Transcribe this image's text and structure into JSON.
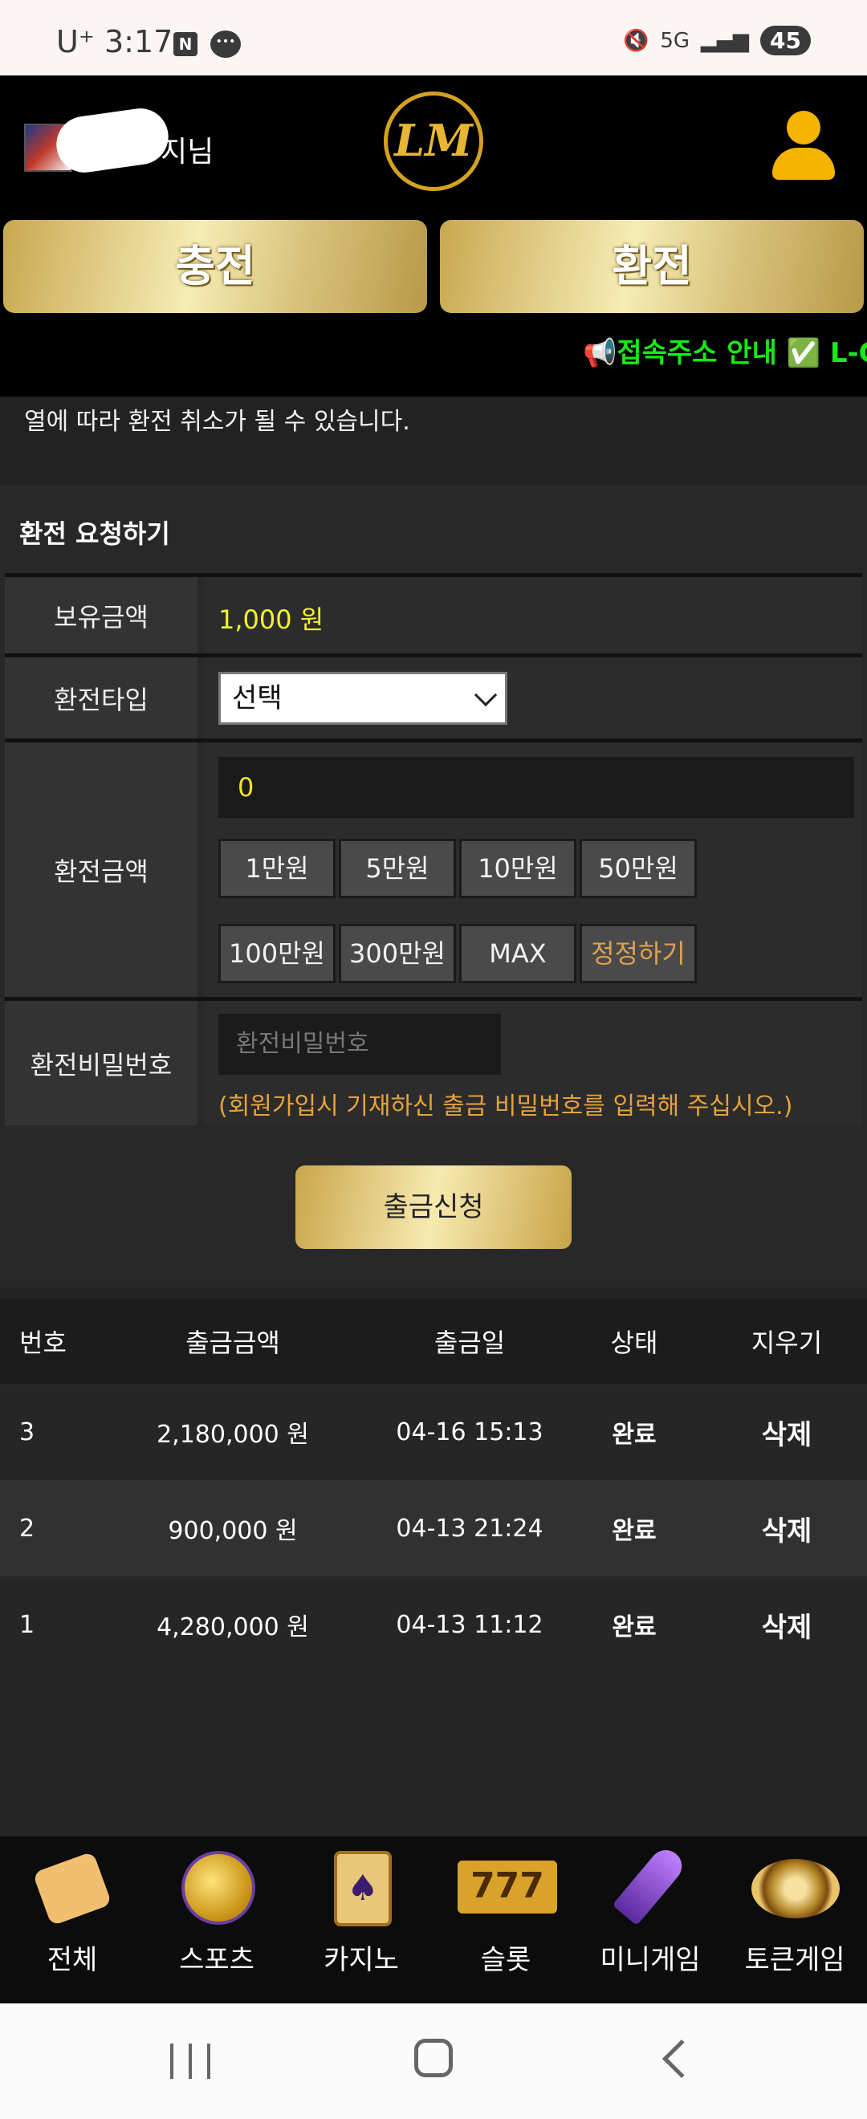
{
  "status_bar": {
    "carrier": "U⁺",
    "time": "3:17",
    "notif_n": "N",
    "network": "5G",
    "battery": "45"
  },
  "header": {
    "user_name": "지님",
    "logo_text": "LM"
  },
  "actions": {
    "charge_label": "충전",
    "exchange_label": "환전"
  },
  "marquee": {
    "text": "📢접속주소 안내 ✅ L-C"
  },
  "notice": {
    "text": "열에 따라 환전 취소가 될 수 있습니다."
  },
  "form": {
    "section_title": "환전 요청하기",
    "balance_label": "보유금액",
    "balance_value": "1,000 원",
    "type_label": "환전타입",
    "type_selected": "선택",
    "amount_label": "환전금액",
    "amount_value": "0",
    "chips": [
      "1만원",
      "5만원",
      "10만원",
      "50만원",
      "100만원",
      "300만원",
      "MAX",
      "정정하기"
    ],
    "password_label": "환전비밀번호",
    "password_placeholder": "환전비밀번호",
    "password_help": "(회원가입시 기재하신 출금 비밀번호를 입력해 주십시오.)",
    "submit_label": "출금신청"
  },
  "history": {
    "headers": [
      "번호",
      "출금금액",
      "출금일",
      "상태",
      "지우기"
    ],
    "rows": [
      {
        "no": "3",
        "amount": "2,180,000 원",
        "date": "04-16 15:13",
        "status": "완료",
        "action": "삭제"
      },
      {
        "no": "2",
        "amount": "900,000 원",
        "date": "04-13 21:24",
        "status": "완료",
        "action": "삭제"
      },
      {
        "no": "1",
        "amount": "4,280,000 원",
        "date": "04-13 11:12",
        "status": "완료",
        "action": "삭제"
      }
    ]
  },
  "bottom_nav": {
    "items": [
      {
        "label": "전체",
        "icon": "dice-icon"
      },
      {
        "label": "스포츠",
        "icon": "soccer-ball-icon"
      },
      {
        "label": "카지노",
        "icon": "cards-icon"
      },
      {
        "label": "슬롯",
        "icon": "slot-machine-icon",
        "icon_text": "777"
      },
      {
        "label": "미니게임",
        "icon": "rocket-icon"
      },
      {
        "label": "토큰게임",
        "icon": "roulette-icon"
      }
    ]
  }
}
